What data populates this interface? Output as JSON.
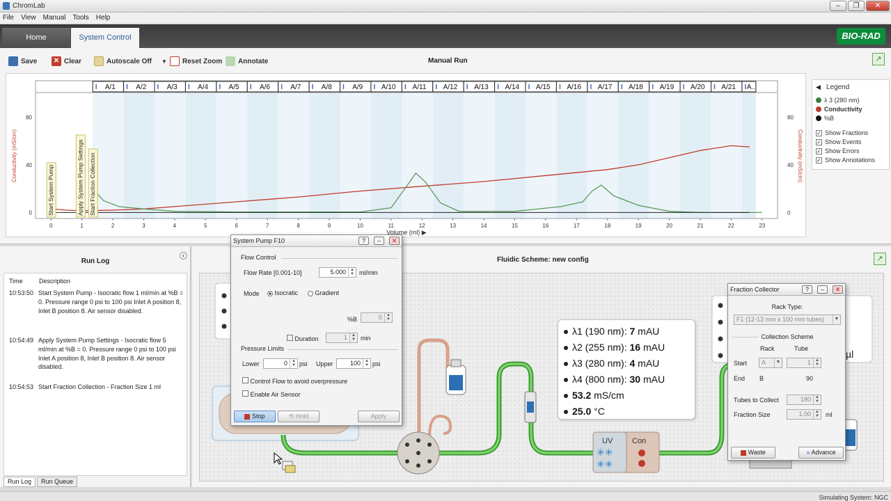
{
  "window": {
    "title": "ChromLab"
  },
  "menu": [
    "File",
    "View",
    "Manual",
    "Tools",
    "Help"
  ],
  "tabs": {
    "home": "Home",
    "system_control": "System Control"
  },
  "brand": "BIO-RAD",
  "toolbar": {
    "save": "Save",
    "clear": "Clear",
    "autoscale": "Autoscale Off",
    "reset_zoom": "Reset Zoom",
    "annotate": "Annotate",
    "title": "Manual Run"
  },
  "chart_data": {
    "type": "line",
    "xlabel": "Volume (ml)",
    "ylabel_left": "Conductivity (mS/cm)",
    "ylabel_right": "Conductivity (mS/cm)",
    "xlim": [
      -0.5,
      23.5
    ],
    "ylim": [
      -5,
      100
    ],
    "x_ticks": [
      0,
      1,
      2,
      3,
      4,
      5,
      6,
      7,
      8,
      9,
      10,
      11,
      12,
      13,
      14,
      15,
      16,
      17,
      18,
      19,
      20,
      21,
      22,
      23
    ],
    "y_ticks": [
      0,
      40,
      80
    ],
    "fractions": [
      "A/1",
      "A/2",
      "A/3",
      "A/4",
      "A/5",
      "A/6",
      "A/7",
      "A/8",
      "A/9",
      "A/10",
      "A/11",
      "A/12",
      "A/13",
      "A/14",
      "A/15",
      "A/16",
      "A/17",
      "A/18",
      "A/19",
      "A/20",
      "A/21",
      "A.."
    ],
    "fraction_start": 1.35,
    "fraction_size": 1,
    "events": [
      {
        "x": 0.0,
        "label": "Start System Pump"
      },
      {
        "x": 0.95,
        "label": "Apply System Pump Settings"
      },
      {
        "x": 1.35,
        "label": "Start Fraction Collection"
      }
    ],
    "series": [
      {
        "name": "Conductivity",
        "color": "#c0392b",
        "x": [
          0,
          0.5,
          1,
          2,
          3,
          4,
          6,
          8,
          10,
          12,
          14,
          16,
          18,
          19,
          20,
          21,
          22,
          22.6
        ],
        "y": [
          3,
          2,
          1.5,
          2,
          3,
          5,
          9,
          13,
          18,
          22,
          26,
          31,
          36,
          40,
          46,
          52,
          56,
          55
        ]
      },
      {
        "name": "λ 3 (280 nm)",
        "color": "#5a9a5a",
        "x": [
          1.35,
          1.7,
          2.2,
          3,
          4,
          6,
          10,
          11,
          11.5,
          11.8,
          12.1,
          12.6,
          13.2,
          15,
          16.5,
          17.2,
          17.5,
          17.8,
          18.2,
          19,
          20,
          21,
          23
        ],
        "y": [
          20,
          10,
          5,
          3,
          1,
          0.5,
          0.5,
          4,
          22,
          33,
          26,
          8,
          1,
          1,
          5,
          9,
          18,
          23,
          14,
          6,
          1,
          0,
          0
        ]
      }
    ]
  },
  "legend": {
    "title": "Legend",
    "items": [
      {
        "label": "λ 3 (280 nm)",
        "color": "#3e7d3e"
      },
      {
        "label": "Conductivity",
        "color": "#c0392b"
      },
      {
        "label": "%B",
        "color": "#111111"
      }
    ],
    "checks": [
      "Show Fractions",
      "Show Events",
      "Show Errors",
      "Show Annotations"
    ]
  },
  "runlog": {
    "title": "Run Log",
    "col_time": "Time",
    "col_desc": "Description",
    "rows": [
      {
        "time": "10:53:50",
        "desc": "Start System Pump - Isocratic flow 1 ml/min at %B = 0. Pressure range 0 psi to 100 psi Inlet A position 8, Inlet B position 8. Air sensor disabled."
      },
      {
        "time": "10:54:49",
        "desc": "Apply System Pump Settings - Isocratic flow 5 ml/min at %B = 0. Pressure range 0 psi to 100 psi Inlet A position 8, Inlet B position 8. Air sensor disabled."
      },
      {
        "time": "10:54:53",
        "desc": "Start Fraction Collection - Fraction Size 1 ml"
      }
    ],
    "tab_runlog": "Run Log",
    "tab_runqueue": "Run Queue"
  },
  "fluidic": {
    "title": "Fluidic Scheme: new config"
  },
  "detector": {
    "rows": [
      {
        "prefix": "λ1 (190 nm): ",
        "value": "7",
        "unit": " mAU"
      },
      {
        "prefix": "λ2 (255 nm): ",
        "value": "16",
        "unit": " mAU"
      },
      {
        "prefix": "λ3 (280 nm): ",
        "value": "4",
        "unit": " mAU"
      },
      {
        "prefix": "λ4 (800 nm): ",
        "value": "30",
        "unit": " mAU"
      },
      {
        "prefix": "",
        "value": "53.2",
        "unit": " mS/cm"
      },
      {
        "prefix": "",
        "value": "25.0",
        "unit": " °C"
      }
    ]
  },
  "uvcon": {
    "uv": "UV",
    "con": "Con"
  },
  "pump_dialog": {
    "title": "System Pump F10",
    "flow_control": "Flow Control",
    "flow_rate_label": "Flow Rate [0.001-10]",
    "flow_rate_value": "5.000",
    "flow_unit": "ml/min",
    "mode_label": "Mode",
    "mode_isocratic": "Isocratic",
    "mode_gradient": "Gradient",
    "pctb_label": "%B",
    "pctb_value": "0",
    "duration_label": "Duration",
    "duration_value": "1",
    "duration_unit": "min",
    "pressure_limits": "Pressure Limits",
    "lower_label": "Lower",
    "lower_value": "0",
    "upper_label": "Upper",
    "upper_value": "100",
    "psi": "psi",
    "control_flow": "Control Flow to avoid overpressure",
    "air_sensor": "Enable Air Sensor",
    "stop": "Stop",
    "hold": "Hold",
    "apply": "Apply"
  },
  "fraction_dialog": {
    "title": "Fraction Collector",
    "rack_type": "Rack Type:",
    "rack_value": "F1 (12-13 mm x 100 mm tubes)",
    "collection_scheme": "Collection Scheme",
    "col_rack": "Rack",
    "col_tube": "Tube",
    "start_label": "Start",
    "start_rack": "A",
    "start_tube": "1",
    "end_label": "End",
    "end_rack": "B",
    "end_tube": "90",
    "tubes_label": "Tubes to Collect",
    "tubes_value": "180",
    "size_label": "Fraction Size",
    "size_value": "1.00",
    "size_unit": "ml",
    "waste": "Waste",
    "advance": "Advance"
  },
  "partial_label": "µl",
  "status": "Simulating System: NGC"
}
